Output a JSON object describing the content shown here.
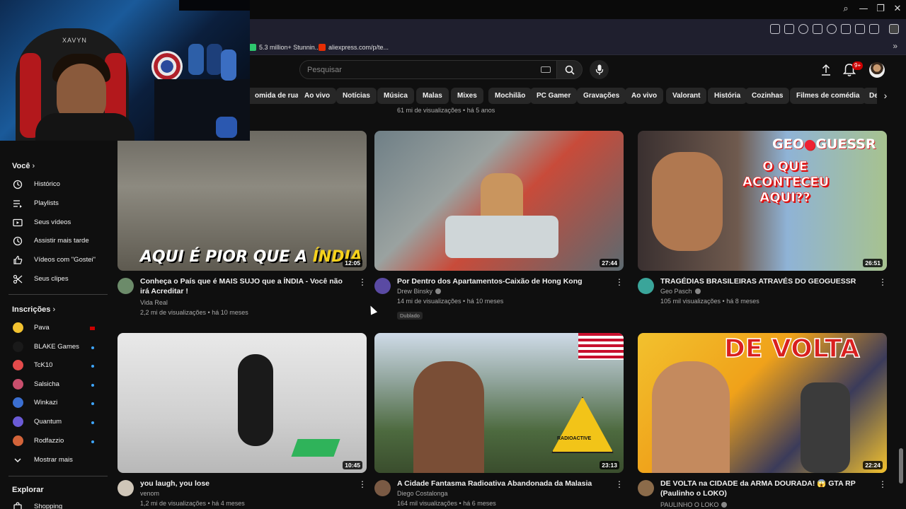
{
  "browser": {
    "bookmarks": [
      {
        "label": "5.3 million+ Stunnin...",
        "icon": "pixabay-icon",
        "color": "#2ec66d"
      },
      {
        "label": "aliexpress.com/p/te...",
        "icon": "aliexpress-icon",
        "color": "#e62e04"
      }
    ]
  },
  "webcam": {
    "chair_brand": "XAVYN"
  },
  "header": {
    "search_placeholder": "Pesquisar",
    "notifications_badge": "9+"
  },
  "chips": [
    "omida de rua",
    "Ao vivo",
    "Notícias",
    "Música",
    "Malas",
    "Mixes",
    "Mochilão",
    "PC Gamer",
    "Gravações",
    "Ao vivo",
    "Valorant",
    "História",
    "Cozinhas",
    "Filmes de comédia",
    "De"
  ],
  "sidebar": {
    "you_heading": "Você",
    "you_items": [
      {
        "label": "Histórico",
        "icon": "history-icon"
      },
      {
        "label": "Playlists",
        "icon": "playlists-icon"
      },
      {
        "label": "Seus vídeos",
        "icon": "your-videos-icon"
      },
      {
        "label": "Assistir mais tarde",
        "icon": "watch-later-icon"
      },
      {
        "label": "Vídeos com \"Gostei\"",
        "icon": "like-icon"
      },
      {
        "label": "Seus clipes",
        "icon": "clips-icon"
      }
    ],
    "subs_heading": "Inscrições",
    "subs_items": [
      {
        "label": "Pava",
        "color": "#f2c230",
        "status": "live"
      },
      {
        "label": "BLAKE Games",
        "color": "#1a1a1a",
        "status": "new"
      },
      {
        "label": "TcK10",
        "color": "#e34b4b",
        "status": "new"
      },
      {
        "label": "Salsicha",
        "color": "#c94f6d",
        "status": "new"
      },
      {
        "label": "Winkazi",
        "color": "#3b6fd1",
        "status": "new"
      },
      {
        "label": "Quantum",
        "color": "#6b5bd6",
        "status": "new"
      },
      {
        "label": "Rodfazzio",
        "color": "#d3643a",
        "status": "new"
      }
    ],
    "show_more": "Mostrar mais",
    "explore_heading": "Explorar",
    "explore_items": [
      {
        "label": "Shopping",
        "icon": "shopping-icon"
      }
    ]
  },
  "previous_row_meta": "61 mi de visualizações • há 5 anos",
  "videos": [
    {
      "title": "Conheça o País que é MAIS SUJO que a ÍNDIA - Você não irá Acreditar !",
      "channel": "Vida Real",
      "meta": "2,2 mi de visualizações • há 10 meses",
      "duration": "12:05",
      "thumb_text": [
        "AQUI É PIOR QUE A ",
        "ÍNDIA"
      ],
      "avatar_color": "#6c8b6a"
    },
    {
      "title": "Por Dentro dos Apartamentos-Caixão de Hong Kong",
      "channel": "Drew Binsky",
      "meta": "14 mi de visualizações • há 10 meses",
      "duration": "27:44",
      "badge": "Dublado",
      "avatar_color": "#5a4aa3",
      "verified": true
    },
    {
      "title": "TRAGÉDIAS BRASILEIRAS ATRAVÉS DO GEOGUESSR",
      "channel": "Geo Pasch",
      "meta": "105 mil visualizações • há 8 meses",
      "duration": "26:51",
      "thumb_text": [
        "GEO",
        "GUESSR",
        "O QUE",
        "ACONTECEU",
        "AQUI??"
      ],
      "avatar_color": "#3aa59a",
      "verified": true
    },
    {
      "title": "you laugh, you lose",
      "channel": "venom",
      "meta": "1,2 mi de visualizações • há 4 meses",
      "duration": "10:45",
      "avatar_color": "#cfc6b8"
    },
    {
      "title": "A Cidade Fantasma Radioativa Abandonada da Malasia",
      "channel": "Diego Costalonga",
      "meta": "164 mil visualizações • há 6 meses",
      "duration": "23:13",
      "thumb_text": [
        "RADIOACTIVE"
      ],
      "avatar_color": "#7a5a44"
    },
    {
      "title": "DE VOLTA na CIDADE da ARMA DOURADA! 😱 GTA RP (Paulinho o LOKO)",
      "channel": "PAULINHO O LOKO",
      "meta": "",
      "duration": "22:24",
      "thumb_text": [
        "DE VOLTA"
      ],
      "avatar_color": "#8b6b4a",
      "verified": true
    }
  ]
}
